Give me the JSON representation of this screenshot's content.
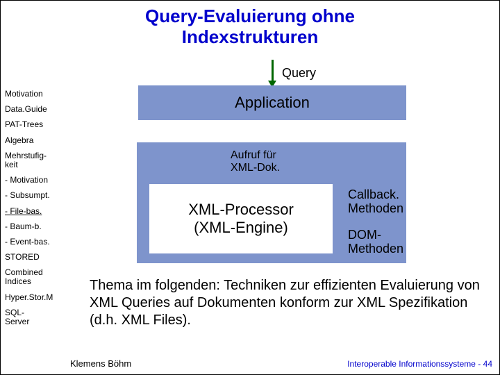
{
  "title_line1": "Query-Evaluierung ohne",
  "title_line2": "Indexstrukturen",
  "query_label": "Query",
  "application_label": "Application",
  "aufruf_line1": "Aufruf für",
  "aufruf_line2": "XML-Dok.",
  "xml_proc_line1": "XML-Processor",
  "xml_proc_line2": "(XML-Engine)",
  "callback_line1": "Callback.",
  "callback_line2": "Methoden",
  "dom_line1": "DOM-",
  "dom_line2": "Methoden",
  "thema": "Thema im folgenden: Techniken zur effizienten Evaluierung von XML Queries auf Dokumenten konform zur XML Spezifikation (d.h. XML Files).",
  "sidebar": {
    "items": [
      "Motivation",
      "Data.Guide",
      "PAT-Trees",
      "Algebra",
      "Mehrstufig-\nkeit",
      "- Motivation",
      "- Subsumpt.",
      "- File-bas.",
      "- Baum-b.",
      "- Event-bas.",
      "STORED",
      "Combined\nIndices",
      "Hyper.Stor.M",
      "SQL-\nServer"
    ]
  },
  "footer_left": "Klemens Böhm",
  "footer_right": "Interoperable Informationssysteme - 44"
}
